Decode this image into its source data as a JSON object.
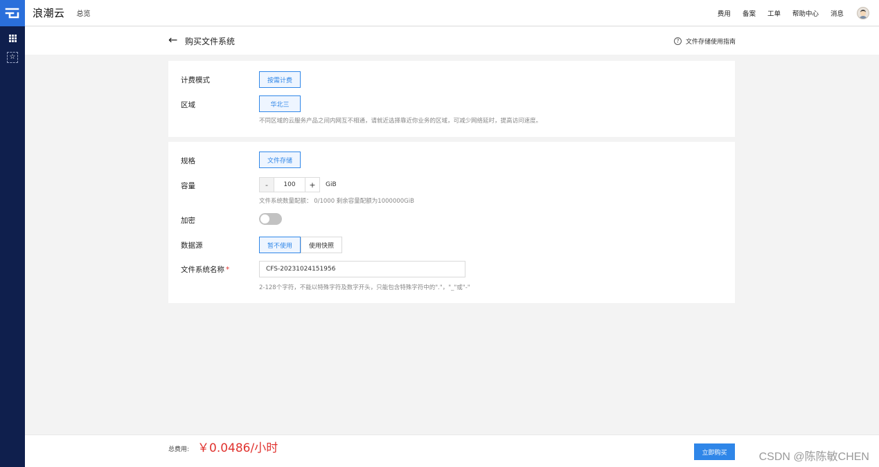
{
  "app": {
    "brand": "浪潮云",
    "overview": "总览"
  },
  "topnav": {
    "items": [
      "费用",
      "备案",
      "工单",
      "帮助中心",
      "消息"
    ]
  },
  "rail": {
    "icons": [
      "logo-icon",
      "grid-icon",
      "star-icon"
    ]
  },
  "page": {
    "title": "购买文件系统",
    "guide": "文件存储使用指南"
  },
  "billing": {
    "label": "计费模式",
    "option": "按需计费"
  },
  "region": {
    "label": "区域",
    "option": "华北三",
    "hint": "不同区域的云服务产品之间内网互不相通，请就近选择靠近你业务的区域，可减少网络延时，提高访问速度。"
  },
  "spec": {
    "label": "规格",
    "option": "文件存储"
  },
  "capacity": {
    "label": "容量",
    "minus": "-",
    "value": "100",
    "plus": "+",
    "unit": "GiB",
    "hint": "文件系统数量配额：  0/1000    剩余容量配额为1000000GiB"
  },
  "encrypt": {
    "label": "加密",
    "enabled": false
  },
  "datasource": {
    "label": "数据源",
    "options": [
      "暂不使用",
      "使用快照"
    ],
    "selected": "暂不使用"
  },
  "fsname": {
    "label": "文件系统名称",
    "required_mark": "*",
    "value": "CFS-20231024151956",
    "hint": "2-128个字符，不能以特殊字符及数字开头，只能包含特殊字符中的\".\"，\"_\"或\"-\""
  },
  "footer": {
    "total_label": "总费用:",
    "total_price": "￥0.0486/小时",
    "buy": "立即购买",
    "watermark": "CSDN @陈陈敏CHEN"
  },
  "colors": {
    "rail": "#0f1f4d",
    "logo_bg": "#2a6fdb",
    "accent": "#2f86e8",
    "price": "#e0332f"
  }
}
